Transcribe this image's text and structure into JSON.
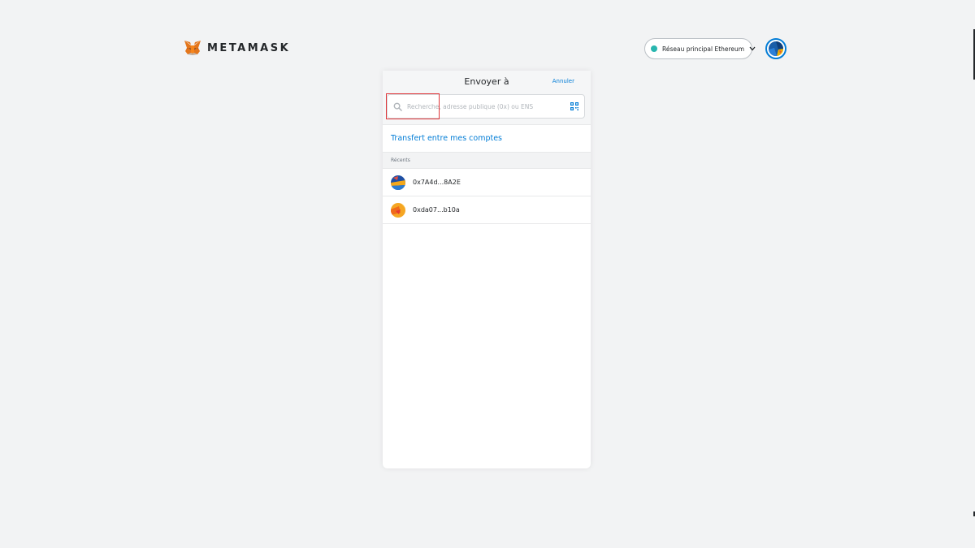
{
  "header": {
    "logo_text": "METAMASK",
    "network_label": "Réseau principal Ethereum",
    "network_color": "#29b6af"
  },
  "send_panel": {
    "title": "Envoyer à",
    "cancel_label": "Annuler",
    "search_placeholder": "Recherche, adresse publique (0x) ou ENS",
    "search_value": "",
    "transfer_label": "Transfert entre mes comptes",
    "recents_label": "Récents",
    "recents": [
      {
        "address": "0x7A4d...8A2E"
      },
      {
        "address": "0xda07...b10a"
      }
    ]
  },
  "colors": {
    "accent": "#037dd6",
    "highlight": "#e0363a",
    "background": "#f2f3f4"
  }
}
